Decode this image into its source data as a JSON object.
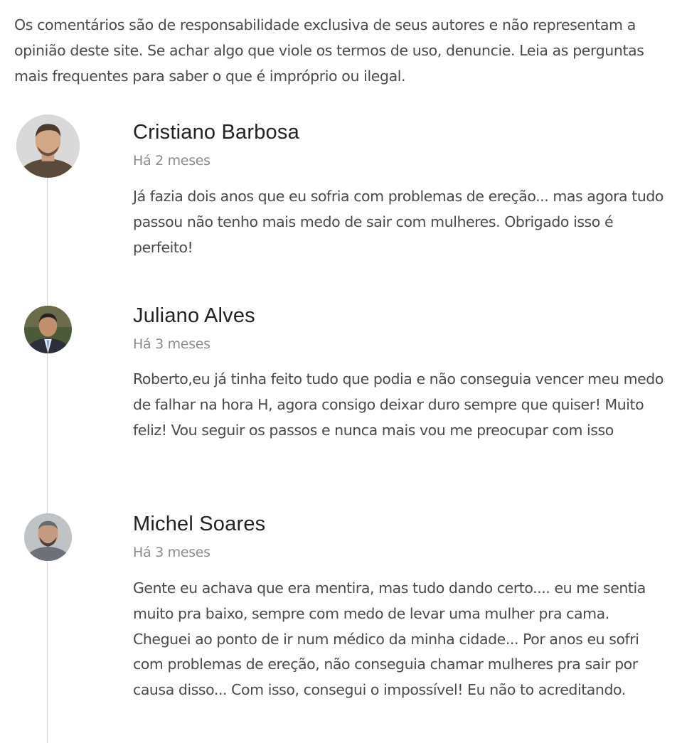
{
  "disclaimer": "Os comentários são de responsabilidade exclusiva de seus autores e não representam a opinião deste site. Se achar algo que viole os termos de uso, denuncie. Leia as perguntas mais frequentes para saber o que é impróprio ou ilegal.",
  "comments": [
    {
      "author": "Cristiano Barbosa",
      "time": "Há 2 meses",
      "text": "Já fazia dois anos que eu sofria com problemas de ereção... mas agora tudo passou não tenho mais medo de sair com mulheres. Obrigado isso é perfeito!"
    },
    {
      "author": "Juliano Alves",
      "time": "Há 3 meses",
      "text": "Roberto,eu já tinha feito tudo que podia e não conseguia vencer meu medo de falhar na hora H, agora consigo deixar duro sempre que quiser! Muito feliz! Vou seguir os passos e nunca mais vou me preocupar com isso"
    },
    {
      "author": "Michel Soares",
      "time": "Há 3 meses",
      "text": "Gente eu achava que era mentira, mas tudo dando certo.... eu me sentia muito pra baixo, sempre com medo de levar uma mulher pra cama. Cheguei ao ponto de ir num médico da minha cidade... Por anos eu sofri com problemas de ereção, não conseguia chamar mulheres pra sair por causa disso... Com isso, consegui o impossível! Eu não to acreditando."
    }
  ],
  "colors": {
    "text": "#4a4a4a",
    "author": "#222222",
    "time": "#8c8c8c",
    "thread_line": "#d6d6d6"
  }
}
